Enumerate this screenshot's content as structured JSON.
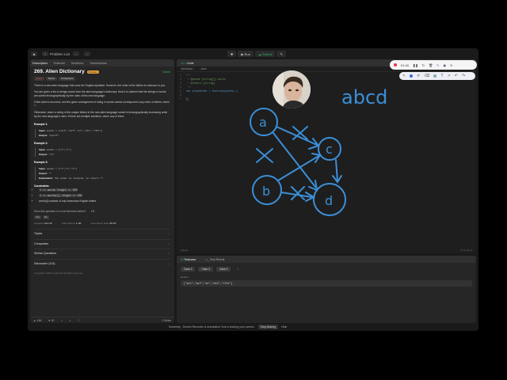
{
  "topbar": {
    "problem_list": "Problem List",
    "run": "Run",
    "submit": "Submit"
  },
  "left_tabs": [
    "Description",
    "Editorial",
    "Solutions",
    "Submissions"
  ],
  "problem": {
    "title": "269. Alien Dictionary",
    "premium": "Premium",
    "solved": "Solved",
    "difficulty": "Hard",
    "topics": "Topics",
    "companies": "Companies",
    "p1": "There is a new alien language that uses the English alphabet. However, the order of the letters is unknown to you.",
    "p2": "You are given a list of strings words from the alien language's dictionary. Now it is claimed that the strings in words are sorted lexicographically by the rules of this new language.",
    "p3": "If this claim is incorrect, and the given arrangement of string in words cannot correspond to any order of letters, return \"\".",
    "p4": "Otherwise, return a string of the unique letters in the new alien language sorted in lexicographically increasing order by the new language's rules. If there are multiple solutions, return any of them.",
    "ex1_title": "Example 1:",
    "ex1_input": "words = [\"wrt\",\"wrf\",\"er\",\"ett\",\"rftt\"]",
    "ex1_output": "\"wertf\"",
    "ex2_title": "Example 2:",
    "ex2_input": "words = [\"z\",\"x\"]",
    "ex2_output": "\"zx\"",
    "ex3_title": "Example 3:",
    "ex3_input": "words = [\"z\",\"x\",\"z\"]",
    "ex3_output": "\"\"",
    "ex3_expl": "The order is invalid, so return \"\".",
    "input_label": "Input:",
    "output_label": "Output:",
    "expl_label": "Explanation:",
    "constraints_title": "Constraints:",
    "constraints": [
      "1 <= words.length <= 100",
      "1 <= words[i].length <= 100",
      "words[i] consists of only lowercase English letters."
    ],
    "interview_q": "Seen this question in a real interview before?",
    "interview_count": "1/5",
    "yes": "Yes",
    "no": "No",
    "accepted_label": "Accepted",
    "accepted": "414.4K",
    "submissions_label": "Submissions",
    "submissions": "1.1M",
    "rate_label": "Acceptance Rate",
    "rate": "36.2%",
    "accordion": [
      "Topics",
      "Companies",
      "Similar Questions",
      "Discussion (113)"
    ],
    "copyright": "Copyright ©2024 LeetCode All rights reserved"
  },
  "left_footer": {
    "likes": "4.6K",
    "dislikes": "1K",
    "online": "1 Online"
  },
  "code": {
    "tab": "Code",
    "language": "JavaScript",
    "mode": "Auto",
    "lines": [
      "/**",
      " * @param {string[]} words",
      " * @return {string}",
      " */",
      "var alienOrder = function(words) {",
      "",
      "};"
    ],
    "saved": "Saved",
    "position": "Ln 1, Col 1"
  },
  "tests": {
    "tab_testcase": "Testcase",
    "tab_result": "Test Result",
    "cases": [
      "Case 1",
      "Case 2",
      "Case 3"
    ],
    "words_label": "words =",
    "words_value": "[\"wrt\",\"wrf\",\"er\",\"ett\",\"rftt\"]"
  },
  "statusbar": {
    "text": "Screenity - Screen Recorder & Annotation Tool is sharing your screen.",
    "stop": "Stop sharing",
    "hide": "Hide"
  },
  "float_bar": {
    "time": "01:40"
  },
  "annotation": {
    "letters": "abcd",
    "nodes": [
      "a",
      "b",
      "c",
      "d"
    ]
  },
  "colors": {
    "accent": "#3b8fd8",
    "success": "#2cbb5d",
    "hard": "#f63737",
    "premium": "#e8a23a"
  }
}
